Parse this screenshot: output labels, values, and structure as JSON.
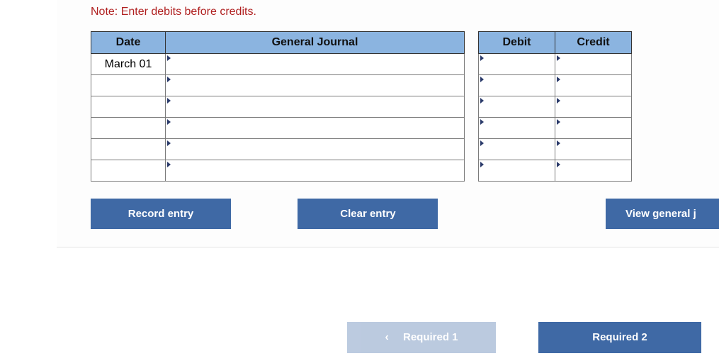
{
  "note": "Note: Enter debits before credits.",
  "headers": {
    "date": "Date",
    "journal": "General Journal",
    "debit": "Debit",
    "credit": "Credit"
  },
  "rows": [
    {
      "date": "March 01",
      "journal": "",
      "debit": "",
      "credit": ""
    },
    {
      "date": "",
      "journal": "",
      "debit": "",
      "credit": ""
    },
    {
      "date": "",
      "journal": "",
      "debit": "",
      "credit": ""
    },
    {
      "date": "",
      "journal": "",
      "debit": "",
      "credit": ""
    },
    {
      "date": "",
      "journal": "",
      "debit": "",
      "credit": ""
    },
    {
      "date": "",
      "journal": "",
      "debit": "",
      "credit": ""
    }
  ],
  "buttons": {
    "record": "Record entry",
    "clear": "Clear entry",
    "view": "View general j"
  },
  "nav": {
    "prev": "Required 1",
    "next": "Required 2"
  }
}
